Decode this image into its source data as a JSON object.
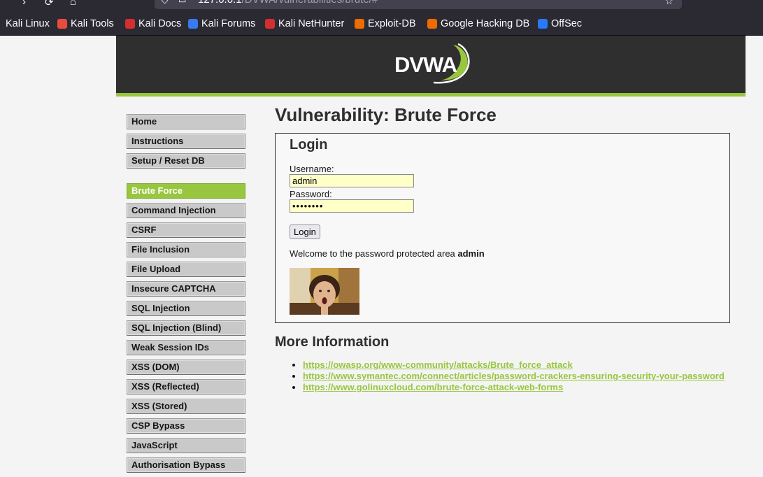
{
  "browser": {
    "url_host": "127.0.0.1",
    "url_path": "/DVWA/vulnerabilities/brute/#",
    "bookmarks": [
      {
        "label": "Kali Linux",
        "icon": "kali-dragon-icon",
        "color": "#367bf0"
      },
      {
        "label": "Kali Tools",
        "icon": "kali-tools-icon",
        "color": "#e74c3c"
      },
      {
        "label": "Kali Docs",
        "icon": "kali-docs-icon",
        "color": "#d32f2f"
      },
      {
        "label": "Kali Forums",
        "icon": "kali-forums-icon",
        "color": "#367bf0"
      },
      {
        "label": "Kali NetHunter",
        "icon": "nethunter-icon",
        "color": "#d32f2f"
      },
      {
        "label": "Exploit-DB",
        "icon": "exploit-db-icon",
        "color": "#ef6c00"
      },
      {
        "label": "Google Hacking DB",
        "icon": "ghdb-icon",
        "color": "#ef6c00"
      },
      {
        "label": "OffSec",
        "icon": "offsec-icon",
        "color": "#2979ff"
      }
    ]
  },
  "header": {
    "logo_text": "DVWA",
    "accent": "#98c63f"
  },
  "sidebar": {
    "groups": [
      [
        {
          "label": "Home"
        },
        {
          "label": "Instructions"
        },
        {
          "label": "Setup / Reset DB"
        }
      ],
      [
        {
          "label": "Brute Force",
          "selected": true
        },
        {
          "label": "Command Injection"
        },
        {
          "label": "CSRF"
        },
        {
          "label": "File Inclusion"
        },
        {
          "label": "File Upload"
        },
        {
          "label": "Insecure CAPTCHA"
        },
        {
          "label": "SQL Injection"
        },
        {
          "label": "SQL Injection (Blind)"
        },
        {
          "label": "Weak Session IDs"
        },
        {
          "label": "XSS (DOM)"
        },
        {
          "label": "XSS (Reflected)"
        },
        {
          "label": "XSS (Stored)"
        },
        {
          "label": "CSP Bypass"
        },
        {
          "label": "JavaScript"
        },
        {
          "label": "Authorisation Bypass"
        }
      ]
    ]
  },
  "main": {
    "title": "Vulnerability: Brute Force",
    "login": {
      "heading": "Login",
      "username_label": "Username:",
      "username_value": "admin",
      "password_label": "Password:",
      "password_mask": "••••••••",
      "button_label": "Login",
      "welcome_text": "Welcome to the password protected area ",
      "welcome_user": "admin"
    },
    "more_info": {
      "heading": "More Information",
      "links": [
        "https://owasp.org/www-community/attacks/Brute_force_attack",
        "https://www.symantec.com/connect/articles/password-crackers-ensuring-security-your-password",
        "https://www.golinuxcloud.com/brute-force-attack-web-forms"
      ]
    }
  }
}
